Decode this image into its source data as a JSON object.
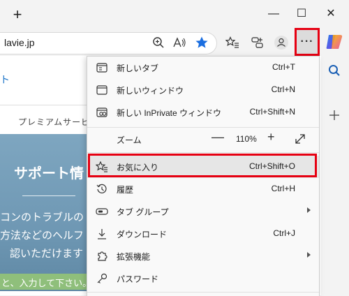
{
  "browser": {
    "new_tab_symbol": "+",
    "window_controls": {
      "minimize": "—",
      "maximize": "☐",
      "close": "✕"
    },
    "address": "lavie.jp",
    "more_button": "···"
  },
  "page": {
    "link_glyph": "ト",
    "nav_text": "プレミアムサービ",
    "hero_title": "サポート情",
    "hero_lines": [
      "コンのトラブルの",
      "方法などのヘルフ",
      "認いただけます"
    ],
    "search_hint": "と、入力して下さい。"
  },
  "menu": {
    "items": [
      {
        "icon": "new-tab-icon",
        "label": "新しいタブ",
        "shortcut": "Ctrl+T"
      },
      {
        "icon": "new-window-icon",
        "label": "新しいウィンドウ",
        "shortcut": "Ctrl+N"
      },
      {
        "icon": "inprivate-icon",
        "label": "新しい InPrivate ウィンドウ",
        "shortcut": "Ctrl+Shift+N"
      },
      {
        "label": "ズーム",
        "zoom_value": "110%",
        "zoom_out": "—",
        "zoom_in": "+",
        "fullscreen_icon": "expand-icon"
      },
      {
        "icon": "favorites-icon",
        "label": "お気に入り",
        "shortcut": "Ctrl+Shift+O"
      },
      {
        "icon": "history-icon",
        "label": "履歴",
        "shortcut": "Ctrl+H"
      },
      {
        "icon": "tab-groups-icon",
        "label": "タブ グループ",
        "submenu": true
      },
      {
        "icon": "download-icon",
        "label": "ダウンロード",
        "shortcut": "Ctrl+J"
      },
      {
        "icon": "extensions-icon",
        "label": "拡張機能",
        "submenu": true
      },
      {
        "icon": "password-icon",
        "label": "パスワード"
      }
    ]
  },
  "colors": {
    "highlight_border": "#e60012",
    "favorites_star": "#1a6ee0"
  }
}
